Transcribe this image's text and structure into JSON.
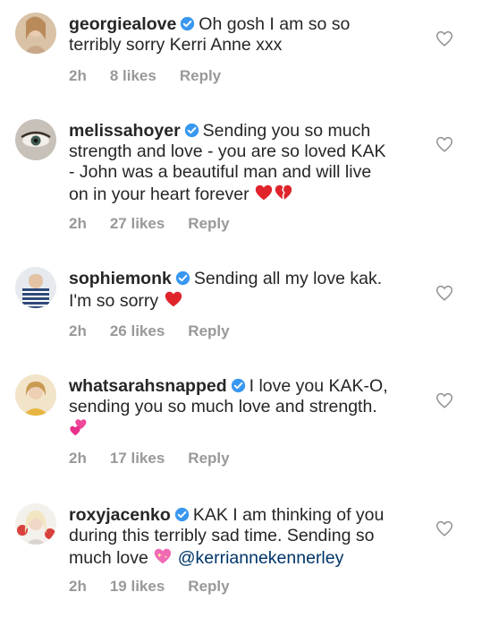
{
  "comments": [
    {
      "username": "georgiealove",
      "text_lines": [
        "Oh gosh I am so so",
        "terribly sorry Kerri Anne xxx"
      ],
      "time": "2h",
      "likes": "8 likes",
      "reply": "Reply",
      "avatar_icon": "avatar-georgiealove"
    },
    {
      "username": "melissahoyer",
      "text_lines": [
        "Sending you so much",
        "strength and love - you are so loved KAK",
        "- John was a beautiful man and will live",
        "on in your heart forever"
      ],
      "emojis": [
        "red-heart-icon",
        "broken-heart-icon"
      ],
      "time": "2h",
      "likes": "27 likes",
      "reply": "Reply",
      "avatar_icon": "avatar-melissahoyer"
    },
    {
      "username": "sophiemonk",
      "text_lines": [
        "Sending all my love kak.",
        "I'm so sorry"
      ],
      "emojis": [
        "red-heart-icon"
      ],
      "time": "2h",
      "likes": "26 likes",
      "reply": "Reply",
      "avatar_icon": "avatar-sophiemonk"
    },
    {
      "username": "whatsarahsnapped",
      "text_lines": [
        "I love you KAK-O,",
        "sending you so much love and strength."
      ],
      "emojis": [
        "two-hearts-icon"
      ],
      "time": "2h",
      "likes": "17 likes",
      "reply": "Reply",
      "avatar_icon": "avatar-whatsarahsnapped"
    },
    {
      "username": "roxyjacenko",
      "text_lines": [
        "KAK I am thinking of you",
        "during this terribly sad time. Sending so",
        "much love"
      ],
      "emojis": [
        "sparkling-heart-icon"
      ],
      "mention": "@kerriannekennerley",
      "time": "2h",
      "likes": "19 likes",
      "reply": "Reply",
      "avatar_icon": "avatar-roxyjacenko"
    }
  ],
  "colors": {
    "text": "#262626",
    "meta": "#999999",
    "verified": "#3897f0",
    "mention": "#003569",
    "heart_outline": "#8e8e8e"
  }
}
